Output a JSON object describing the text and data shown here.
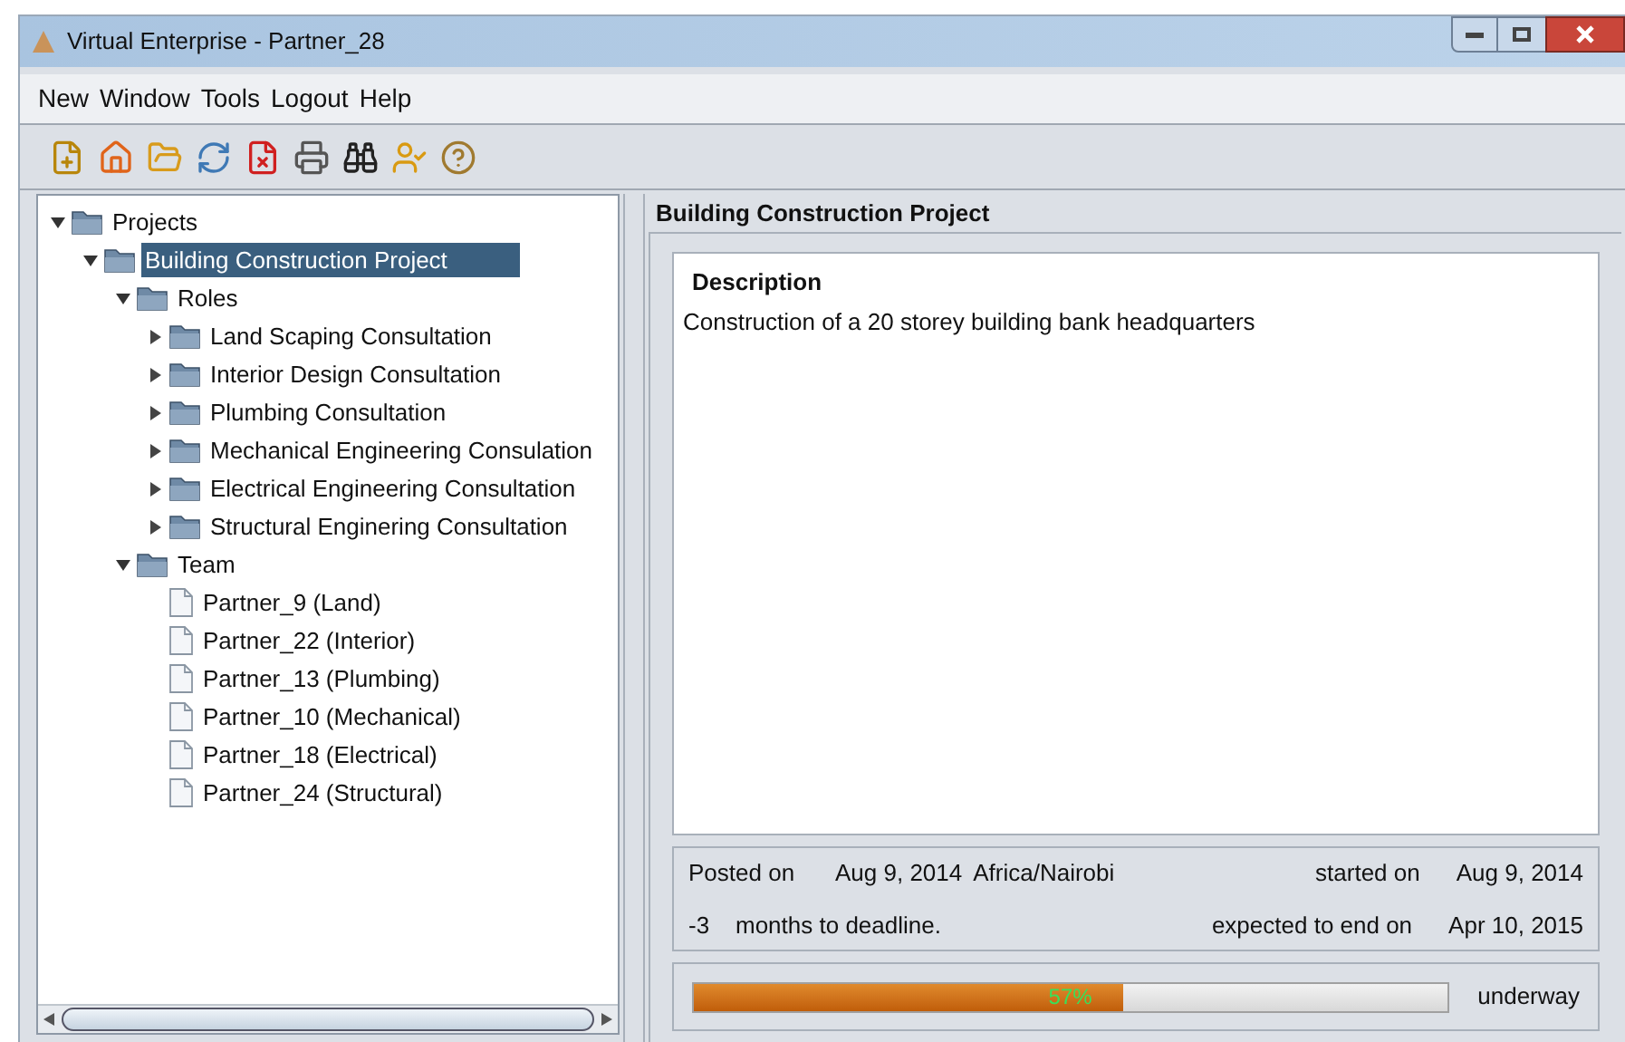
{
  "window": {
    "title": "Virtual Enterprise - Partner_28"
  },
  "menu": [
    "New",
    "Window",
    "Tools",
    "Logout",
    "Help"
  ],
  "tree": [
    {
      "label": "Projects",
      "kind": "folder",
      "expanded": true,
      "selected": false,
      "children": [
        {
          "label": "Building Construction Project",
          "kind": "folder",
          "expanded": true,
          "selected": true,
          "children": [
            {
              "label": "Roles",
              "kind": "folder",
              "expanded": true,
              "selected": false,
              "children": [
                {
                  "label": "Land Scaping Consultation",
                  "kind": "folder",
                  "expanded": false,
                  "selected": false
                },
                {
                  "label": "Interior Design Consultation",
                  "kind": "folder",
                  "expanded": false,
                  "selected": false
                },
                {
                  "label": "Plumbing Consultation",
                  "kind": "folder",
                  "expanded": false,
                  "selected": false
                },
                {
                  "label": "Mechanical Engineering Consulation",
                  "kind": "folder",
                  "expanded": false,
                  "selected": false
                },
                {
                  "label": "Electrical Engineering Consultation",
                  "kind": "folder",
                  "expanded": false,
                  "selected": false
                },
                {
                  "label": "Structural Enginering Consultation",
                  "kind": "folder",
                  "expanded": false,
                  "selected": false
                }
              ]
            },
            {
              "label": "Team",
              "kind": "folder",
              "expanded": true,
              "selected": false,
              "children": [
                {
                  "label": "Partner_9 (Land)",
                  "kind": "file",
                  "selected": false
                },
                {
                  "label": "Partner_22 (Interior)",
                  "kind": "file",
                  "selected": false
                },
                {
                  "label": "Partner_13 (Plumbing)",
                  "kind": "file",
                  "selected": false
                },
                {
                  "label": "Partner_10 (Mechanical)",
                  "kind": "file",
                  "selected": false
                },
                {
                  "label": "Partner_18 (Electrical)",
                  "kind": "file",
                  "selected": false
                },
                {
                  "label": "Partner_24 (Structural)",
                  "kind": "file",
                  "selected": false
                }
              ]
            }
          ]
        }
      ]
    }
  ],
  "detail": {
    "title": "Building Construction Project",
    "description_heading": "Description",
    "description": "Construction of a 20 storey building bank headquarters",
    "posted_label": "Posted on",
    "posted_date": "Aug 9, 2014",
    "timezone": "Africa/Nairobi",
    "started_label": "started on",
    "started_date": "Aug 9, 2014",
    "months": "-3",
    "deadline_text": "months to deadline.",
    "end_label": "expected to end on",
    "end_date": "Apr 10, 2015",
    "progress": {
      "level": 0.57,
      "reading": "57%"
    },
    "status": "underway"
  }
}
